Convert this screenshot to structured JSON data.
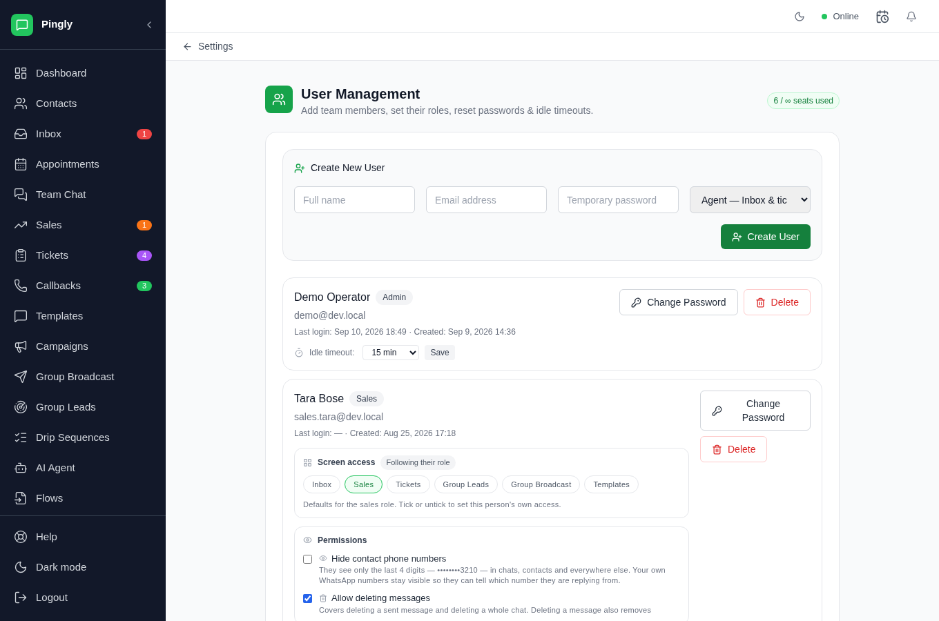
{
  "sidebar": {
    "brand": "Pingly",
    "items": [
      {
        "label": "Dashboard"
      },
      {
        "label": "Contacts"
      },
      {
        "label": "Inbox",
        "badge": "1",
        "color": "#ef4444"
      },
      {
        "label": "Appointments"
      },
      {
        "label": "Team Chat"
      },
      {
        "label": "Sales",
        "badge": "1",
        "color": "#f97316"
      },
      {
        "label": "Tickets",
        "badge": "4",
        "color": "#a855f7"
      },
      {
        "label": "Callbacks",
        "badge": "3",
        "color": "#22c55e"
      },
      {
        "label": "Templates"
      },
      {
        "label": "Campaigns"
      },
      {
        "label": "Group Broadcast"
      },
      {
        "label": "Group Leads"
      },
      {
        "label": "Drip Sequences"
      },
      {
        "label": "AI Agent"
      },
      {
        "label": "Flows"
      }
    ],
    "footer": [
      {
        "label": "Help"
      },
      {
        "label": "Dark mode"
      },
      {
        "label": "Logout"
      }
    ]
  },
  "topbar": {
    "status": "Online"
  },
  "breadcrumb": "Settings",
  "page": {
    "title": "User Management",
    "subtitle": "Add team members, set their roles, reset passwords & idle timeouts.",
    "seats": "6 / ∞ seats used"
  },
  "create_form": {
    "title": "Create New User",
    "fields": [
      {
        "placeholder": "Full name"
      },
      {
        "placeholder": "Email address"
      },
      {
        "placeholder": "Temporary password"
      }
    ],
    "role": "Agent — Inbox & tic",
    "button": "Create User"
  },
  "users": [
    {
      "name": "Demo Operator",
      "role": "Admin",
      "email": "demo@dev.local",
      "meta": "Last login: Sep 10, 2026 18:49 · Created: Sep 9, 2026 14:36",
      "idle_label": "Idle timeout:",
      "idle_value": "15 min",
      "save": "Save",
      "change_password": "Change Password",
      "delete": "Delete"
    },
    {
      "name": "Tara Bose",
      "role": "Sales",
      "email": "sales.tara@dev.local",
      "meta": "Last login: — · Created: Aug 25, 2026 17:18",
      "change_password": "Change Password",
      "delete": "Delete",
      "screen_access": {
        "title": "Screen access",
        "tag": "Following their role",
        "chips": [
          {
            "label": "Inbox",
            "selected": false
          },
          {
            "label": "Sales",
            "selected": true
          },
          {
            "label": "Tickets",
            "selected": false
          },
          {
            "label": "Group Leads",
            "selected": false
          },
          {
            "label": "Group Broadcast",
            "selected": false
          },
          {
            "label": "Templates",
            "selected": false
          }
        ],
        "note": "Defaults for the sales role. Tick or untick to set this person's own access."
      },
      "permissions": {
        "title": "Permissions",
        "items": [
          {
            "label": "Hide contact phone numbers",
            "checked": false,
            "description": "They see only the last 4 digits — ••••••••3210 — in chats, contacts and everywhere else. Your own WhatsApp numbers stay visible so they can tell which number they are replying from."
          },
          {
            "label": "Allow deleting messages",
            "checked": true,
            "description": "Covers deleting a sent message and deleting a whole chat. Deleting a message also removes"
          }
        ]
      }
    }
  ]
}
